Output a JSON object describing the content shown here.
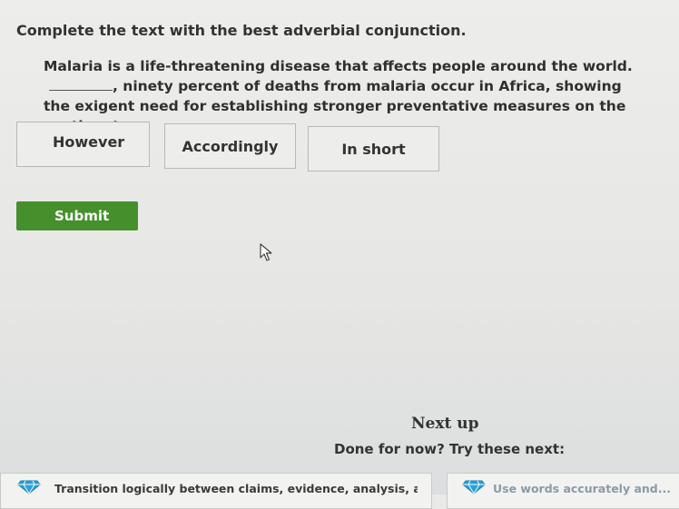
{
  "question": {
    "instruction": "Complete the text with the best adverbial conjunction.",
    "passage_before": "Malaria is a life-threatening disease that affects people around the world.",
    "passage_after": ", ninety percent of deaths from malaria occur in Africa, showing the exigent need for establishing stronger preventative measures on the continent."
  },
  "choices": [
    {
      "label": "However"
    },
    {
      "label": "Accordingly"
    },
    {
      "label": "In short"
    }
  ],
  "submit_label": "Submit",
  "next": {
    "heading": "Next up",
    "subheading": "Done for now? Try these next:"
  },
  "recommendations": [
    {
      "text": "Transition logically between claims, evidence, analysis, and counte...",
      "icon": "diamond-icon",
      "color": "#2aa0d8"
    },
    {
      "text": "Use words accurately and...",
      "icon": "diamond-icon",
      "color": "#2aa0d8"
    }
  ],
  "colors": {
    "submit_bg": "#45902c",
    "background": "#e9e9e7"
  }
}
